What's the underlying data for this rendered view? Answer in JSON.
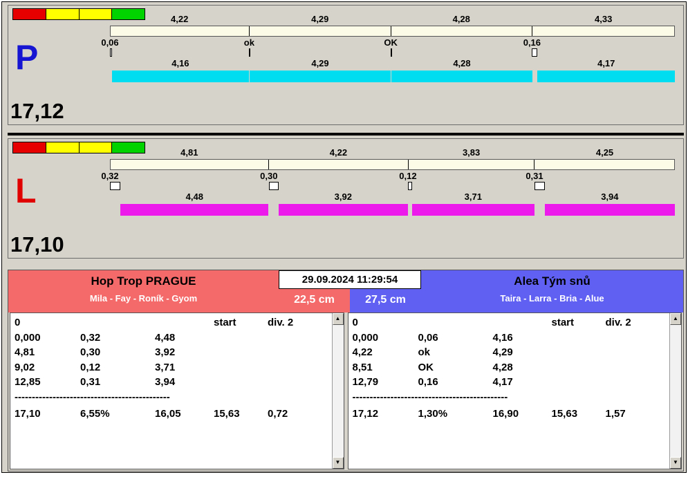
{
  "legend": [
    "#e60000",
    "#ffff00",
    "#ffff00",
    "#00d300"
  ],
  "icons": {
    "up": "▲",
    "down": "▼"
  },
  "panels": [
    {
      "letter": "P",
      "letter_color": "#1616d2",
      "total": "17,12",
      "bar_color": "#00ddf0",
      "top": {
        "s0": {
          "label": "4,22",
          "w": 4.22
        },
        "s1": {
          "label": "4,29",
          "w": 4.29
        },
        "s2": {
          "label": "4,28",
          "w": 4.28
        },
        "s3": {
          "label": "4,33",
          "w": 4.33
        }
      },
      "trans": {
        "t0": {
          "label": "0,06",
          "pos": 0,
          "w": 0.35
        },
        "t1": {
          "label": "ok",
          "pos": 24.65,
          "w": 0.12
        },
        "t2": {
          "label": "OK",
          "pos": 49.71,
          "w": 0.12
        },
        "t3": {
          "label": "0,16",
          "pos": 74.71,
          "w": 0.93
        }
      },
      "bars": {
        "g0": 0.06,
        "b0": {
          "label": "4,16",
          "w": 4.16
        },
        "g1": 0.02,
        "b1": {
          "label": "4,29",
          "w": 4.29
        },
        "g2": 0.02,
        "b2": {
          "label": "4,28",
          "w": 4.28
        },
        "g3": 0.16,
        "b3": {
          "label": "4,17",
          "w": 4.17
        }
      }
    },
    {
      "letter": "L",
      "letter_color": "#e00000",
      "total": "17,10",
      "bar_color": "#ec1bec",
      "top": {
        "s0": {
          "label": "4,81",
          "w": 4.81
        },
        "s1": {
          "label": "4,22",
          "w": 4.22
        },
        "s2": {
          "label": "3,83",
          "w": 3.83
        },
        "s3": {
          "label": "4,25",
          "w": 4.25
        }
      },
      "trans": {
        "t0": {
          "label": "0,32",
          "pos": 0,
          "w": 1.87
        },
        "t1": {
          "label": "0,30",
          "pos": 28.13,
          "w": 1.75
        },
        "t2": {
          "label": "0,12",
          "pos": 52.75,
          "w": 0.7
        },
        "t3": {
          "label": "0,31",
          "pos": 75.15,
          "w": 1.81
        }
      },
      "bars": {
        "g0": 0.32,
        "b0": {
          "label": "4,48",
          "w": 4.48
        },
        "g1": 0.3,
        "b1": {
          "label": "3,92",
          "w": 3.92
        },
        "g2": 0.12,
        "b2": {
          "label": "3,71",
          "w": 3.71
        },
        "g3": 0.31,
        "b3": {
          "label": "3,94",
          "w": 3.94
        }
      }
    }
  ],
  "scoreboard": {
    "datetime": "29.09.2024 11:29:54",
    "left": {
      "bg": "#f46a6a",
      "team": "Hop Trop PRAGUE",
      "members": "Mila - Fay - Roník - Gyom",
      "lane": "22,5 cm",
      "head": {
        "c1": "0",
        "c4": "start",
        "c5": "div. 2"
      },
      "rows": [
        [
          "0,000",
          "0,32",
          "4,48"
        ],
        [
          "4,81",
          "0,30",
          "3,92"
        ],
        [
          "9,02",
          "0,12",
          "3,71"
        ],
        [
          "12,85",
          "0,31",
          "3,94"
        ]
      ],
      "dashes": "---------------------------------------------",
      "total": [
        "17,10",
        "6,55%",
        "16,05",
        "15,63",
        "0,72"
      ]
    },
    "right": {
      "bg": "#6060f2",
      "team": "Alea Tým snů",
      "members": "Taira - Larra - Bria - Alue",
      "lane": "27,5 cm",
      "head": {
        "c1": "0",
        "c4": "start",
        "c5": "div. 2"
      },
      "rows": [
        [
          "0,000",
          "0,06",
          "4,16"
        ],
        [
          "4,22",
          "ok",
          "4,29"
        ],
        [
          "8,51",
          "OK",
          "4,28"
        ],
        [
          "12,79",
          "0,16",
          "4,17"
        ]
      ],
      "dashes": "---------------------------------------------",
      "total": [
        "17,12",
        "1,30%",
        "16,90",
        "15,63",
        "1,57"
      ]
    }
  }
}
